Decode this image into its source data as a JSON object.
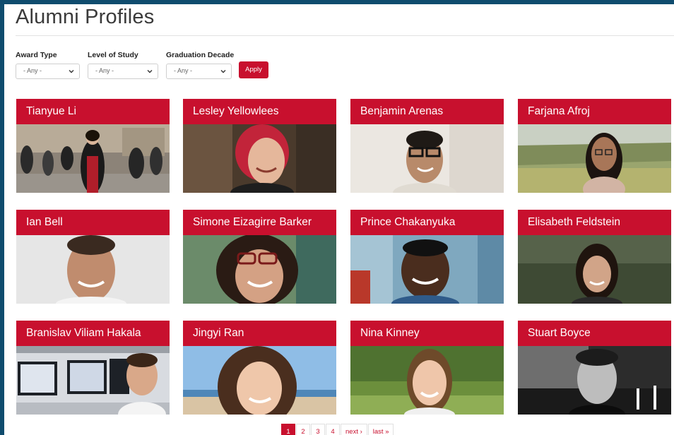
{
  "page": {
    "title": "Alumni Profiles"
  },
  "filters": [
    {
      "label": "Award Type",
      "value": "- Any -"
    },
    {
      "label": "Level of Study",
      "value": "- Any -"
    },
    {
      "label": "Graduation Decade",
      "value": "- Any -"
    }
  ],
  "apply_label": "Apply",
  "profiles": [
    {
      "name": "Tianyue Li"
    },
    {
      "name": "Lesley Yellowlees"
    },
    {
      "name": "Benjamin Arenas"
    },
    {
      "name": "Farjana Afroj"
    },
    {
      "name": "Ian Bell"
    },
    {
      "name": "Simone Eizagirre Barker"
    },
    {
      "name": "Prince Chakanyuka"
    },
    {
      "name": "Elisabeth Feldstein"
    },
    {
      "name": "Branislav Viliam Hakala"
    },
    {
      "name": "Jingyi Ran"
    },
    {
      "name": "Nina Kinney"
    },
    {
      "name": "Stuart Boyce"
    }
  ],
  "pagination": {
    "pages": [
      "1",
      "2",
      "3",
      "4"
    ],
    "next": "next ›",
    "last": "last »",
    "current": "1"
  },
  "colors": {
    "accent": "#c8102e",
    "frame": "#0f4c6e"
  }
}
